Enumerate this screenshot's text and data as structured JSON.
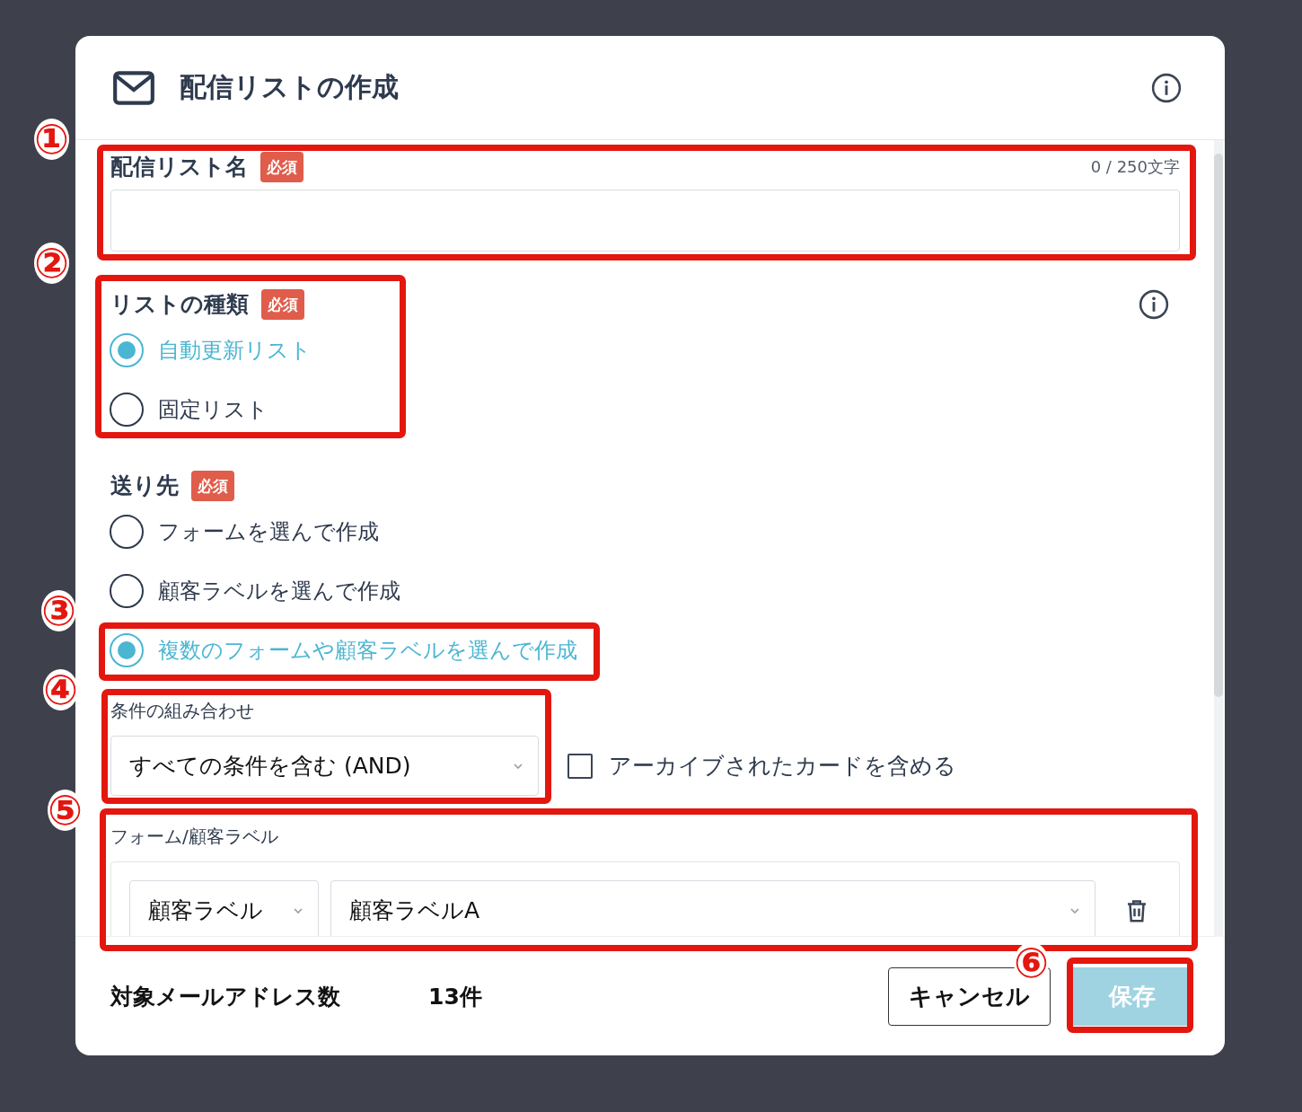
{
  "dialog": {
    "title": "配信リストの作成"
  },
  "list_name": {
    "label": "配信リスト名",
    "required": "必須",
    "counter": "0 / 250文字"
  },
  "list_type": {
    "label": "リストの種類",
    "required": "必須",
    "options": [
      {
        "label": "自動更新リスト",
        "selected": true
      },
      {
        "label": "固定リスト",
        "selected": false
      }
    ]
  },
  "recipients": {
    "label": "送り先",
    "required": "必須",
    "options": [
      {
        "label": "フォームを選んで作成",
        "selected": false
      },
      {
        "label": "顧客ラベルを選んで作成",
        "selected": false
      },
      {
        "label": "複数のフォームや顧客ラベルを選んで作成",
        "selected": true
      }
    ]
  },
  "condition": {
    "label": "条件の組み合わせ",
    "value": "すべての条件を含む (AND)"
  },
  "archive_checkbox": {
    "label": "アーカイブされたカードを含める",
    "checked": false
  },
  "form_labels": {
    "label": "フォーム/顧客ラベル",
    "rows": [
      {
        "type": "顧客ラベル",
        "value": "顧客ラベルA"
      }
    ]
  },
  "footer": {
    "count_label": "対象メールアドレス数",
    "count": "13件",
    "buttons": [
      {
        "label": "キャンセル",
        "kind": "secondary",
        "disabled": false
      },
      {
        "label": "保存",
        "kind": "primary",
        "disabled": true
      }
    ]
  },
  "annotations": [
    {
      "number": "①"
    },
    {
      "number": "②"
    },
    {
      "number": "③"
    },
    {
      "number": "④"
    },
    {
      "number": "⑤"
    },
    {
      "number": "⑥"
    }
  ]
}
